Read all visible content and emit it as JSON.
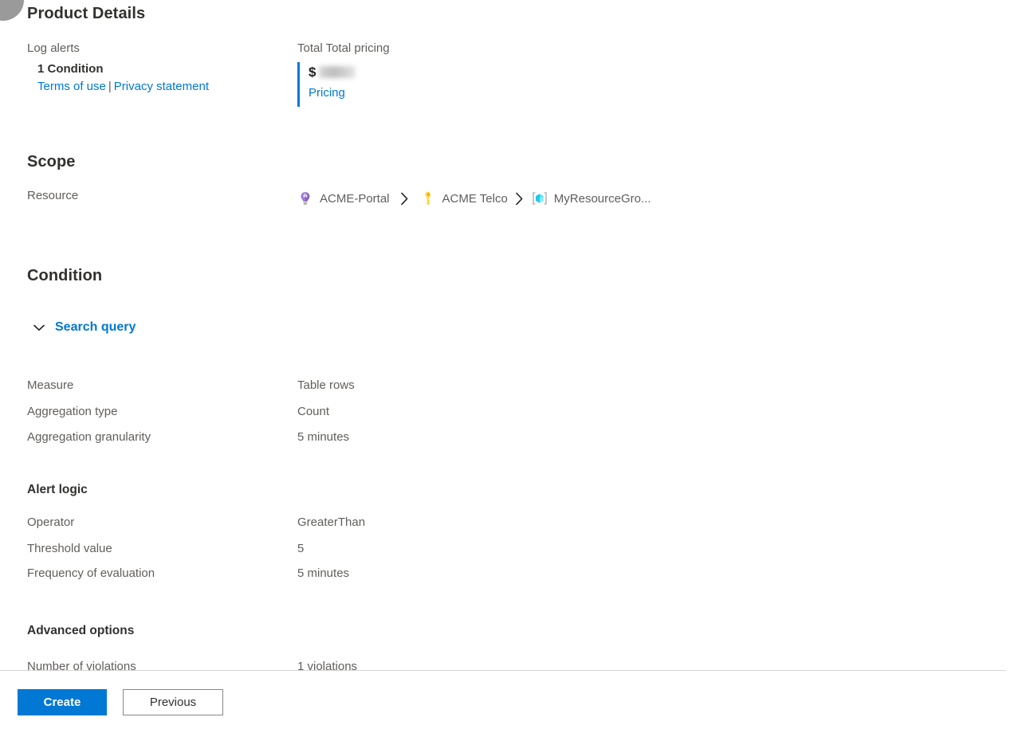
{
  "product_details": {
    "heading": "Product Details",
    "left": {
      "column_title": "Log alerts",
      "condition": "1 Condition",
      "terms_link": "Terms of use",
      "separator": "|",
      "privacy_link": "Privacy statement"
    },
    "right": {
      "column_title": "Total Total pricing",
      "currency_symbol": "$",
      "amount": "",
      "pricing_link": "Pricing"
    }
  },
  "scope": {
    "heading": "Scope",
    "label": "Resource",
    "breadcrumb": [
      {
        "name": "ACME-Portal",
        "icon": "tenant-bulb-icon"
      },
      {
        "name": "ACME Telco",
        "icon": "subscription-key-icon"
      },
      {
        "name": "MyResourceGro...",
        "icon": "resource-group-cube-icon"
      }
    ],
    "separator": "›"
  },
  "condition": {
    "heading": "Condition",
    "search_query": {
      "label": "Search query",
      "expanded": true,
      "chevron": "chevron-down-icon"
    },
    "rows": [
      {
        "key": "Measure",
        "value": "Table rows"
      },
      {
        "key": "Aggregation type",
        "value": "Count"
      },
      {
        "key": "Aggregation granularity",
        "value": "5 minutes"
      }
    ],
    "alert_logic": {
      "heading": "Alert logic",
      "rows": [
        {
          "key": "Operator",
          "value": "GreaterThan"
        },
        {
          "key": "Threshold value",
          "value": "5"
        },
        {
          "key": "Frequency of evaluation",
          "value": "5 minutes"
        }
      ]
    },
    "advanced_options": {
      "heading": "Advanced options",
      "rows": [
        {
          "key": "Number of violations",
          "value": "1 violations"
        }
      ]
    }
  },
  "footer": {
    "create_label": "Create",
    "previous_label": "Previous"
  },
  "colors": {
    "accent": "#0078d4",
    "text_primary": "#323130",
    "text_secondary": "#605e5c",
    "divider": "#d6d6d6",
    "tenant_icon": "#8661c5",
    "key_icon": "#ffc400",
    "resource_group_icon": "#50e6ff"
  }
}
